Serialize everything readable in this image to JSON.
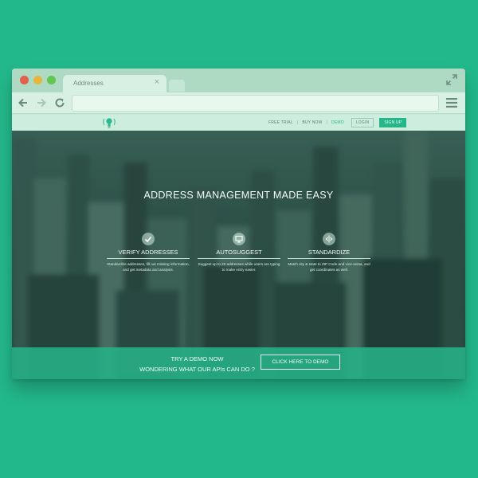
{
  "browser": {
    "tab_title": "Addresses",
    "tab_close_glyph": "×",
    "icons": [
      "back-arrow-icon",
      "forward-arrow-icon",
      "reload-icon",
      "fullscreen-icon",
      "menu-icon"
    ],
    "address_value": ""
  },
  "site": {
    "logo_icon": "lightbulb-icon",
    "nav": {
      "free_trial": "FREE TRIAL",
      "sep1": "|",
      "buy_now": "BUY NOW",
      "sep2": "|",
      "demo": "DEMO",
      "login": "LOGIN",
      "signup": "SIGN UP"
    },
    "hero_title": "ADDRESS MANAGEMENT MADE EASY",
    "features": [
      {
        "icon": "checkmark-icon",
        "title": "VERIFY ADDRESSES",
        "desc": "Standardize addresses, fill out missing information, and get metadata and analysis."
      },
      {
        "icon": "monitor-icon",
        "title": "AUTOSUGGEST",
        "desc": "Suggest up to 20 addresses while users are typing to make entry easier."
      },
      {
        "icon": "swap-arrows-icon",
        "title": "STANDARDIZE",
        "desc": "Match city & state to ZIP Code and vice-versa, and get coordinates as well."
      }
    ],
    "cta": {
      "line1": "TRY A DEMO NOW",
      "line2": "WONDERING WHAT OUR APIs CAN DO ?",
      "button": "CLICK HERE TO DEMO"
    }
  },
  "colors": {
    "background": "#23b88b",
    "accent": "#26b68a",
    "browser_chrome": "#d7f0e3"
  }
}
